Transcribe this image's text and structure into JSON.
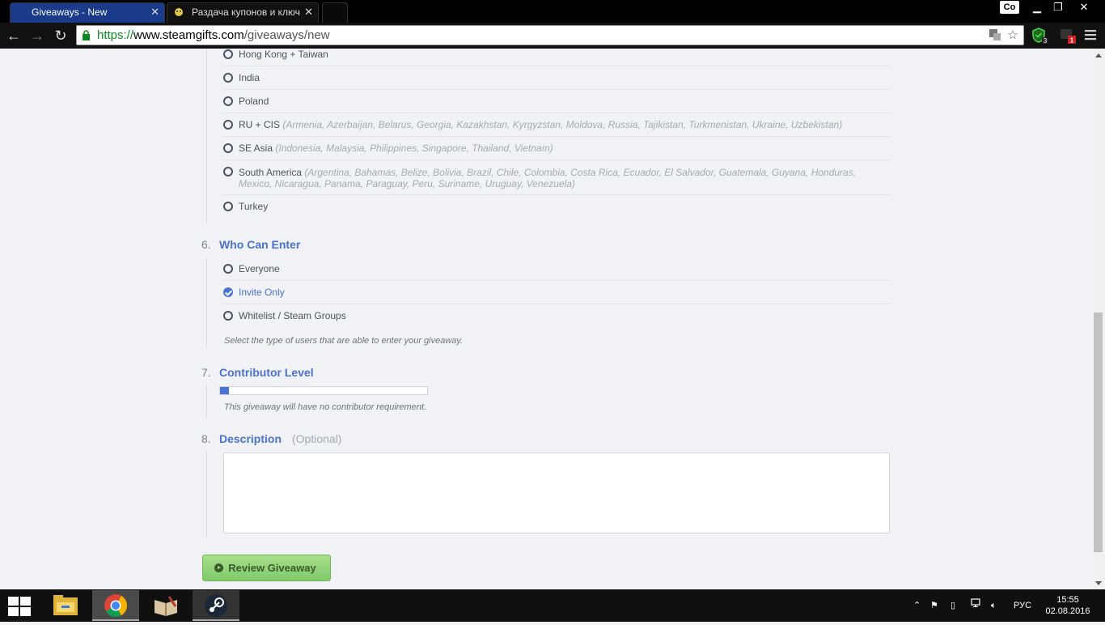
{
  "browser": {
    "tabs": [
      {
        "title": "Giveaways - New",
        "active": true
      },
      {
        "title": "Раздача купонов и ключ",
        "active": false
      }
    ],
    "profile_label": "Co",
    "url": {
      "scheme": "https://",
      "host": "www.steamgifts.com",
      "path": "/giveaways/new"
    },
    "extension_badges": {
      "shield": "3",
      "red": "1"
    }
  },
  "regions": [
    {
      "name": "Hong Kong + Taiwan",
      "countries": ""
    },
    {
      "name": "India",
      "countries": ""
    },
    {
      "name": "Poland",
      "countries": ""
    },
    {
      "name": "RU + CIS",
      "countries": "(Armenia, Azerbaijan, Belarus, Georgia, Kazakhstan, Kyrgyzstan, Moldova, Russia, Tajikistan, Turkmenistan, Ukraine, Uzbekistan)"
    },
    {
      "name": "SE Asia",
      "countries": "(Indonesia, Malaysia, Philippines, Singapore, Thailand, Vietnam)"
    },
    {
      "name": "South America",
      "countries": "(Argentina, Bahamas, Belize, Bolivia, Brazil, Chile, Colombia, Costa Rica, Ecuador, El Salvador, Guatemala, Guyana, Honduras, Mexico, Nicaragua, Panama, Paraguay, Peru, Suriname, Uruguay, Venezuela)"
    },
    {
      "name": "Turkey",
      "countries": ""
    }
  ],
  "who_can_enter": {
    "number": "6.",
    "title": "Who Can Enter",
    "options": [
      "Everyone",
      "Invite Only",
      "Whitelist / Steam Groups"
    ],
    "selected": "Invite Only",
    "hint": "Select the type of users that are able to enter your giveaway."
  },
  "contributor_level": {
    "number": "7.",
    "title": "Contributor Level",
    "value": 0,
    "hint": "This giveaway will have no contributor requirement."
  },
  "description": {
    "number": "8.",
    "title": "Description",
    "optional": "(Optional)",
    "value": ""
  },
  "review_button": "Review Giveaway",
  "taskbar": {
    "language": "РУС",
    "time": "15:55",
    "date": "02.08.2016"
  },
  "colors": {
    "accent": "#4b72d4",
    "button": "#8fd374",
    "tab_active": "#1a3a8a"
  }
}
